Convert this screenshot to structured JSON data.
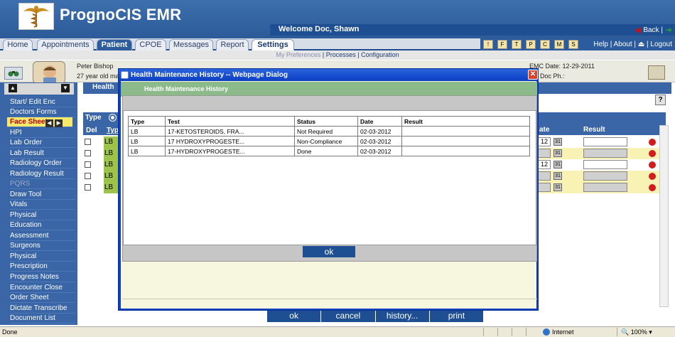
{
  "app": {
    "title": "PrognoCIS EMR",
    "welcome": "Welcome Doc, Shawn",
    "back_label": "Back |"
  },
  "tabs": [
    {
      "label": "Home"
    },
    {
      "label": "Appointments"
    },
    {
      "label": "Patient"
    },
    {
      "label": "CPOE"
    },
    {
      "label": "Messages"
    },
    {
      "label": "Report"
    },
    {
      "label": "Settings"
    }
  ],
  "help_links": "Help | About | ⏏ | Logout",
  "subnav": {
    "my_preferences": "My Preferences",
    "processes": "Processes",
    "configuration": "Configuration"
  },
  "patient": {
    "name": "Peter Bishop",
    "age": "27 year old mal",
    "emc_date": "EMC Date: 12-29-2011",
    "doc_ph": "Doc Ph.:"
  },
  "sidebar": {
    "items": [
      {
        "label": "Start/ Edit Enc"
      },
      {
        "label": "Doctors Forms"
      },
      {
        "label": "Face Sheet"
      },
      {
        "label": "HPI"
      },
      {
        "label": "Lab Order"
      },
      {
        "label": "Lab Result"
      },
      {
        "label": "Radiology Order"
      },
      {
        "label": "Radiology Result"
      },
      {
        "label": "PQRS"
      },
      {
        "label": "Draw Tool"
      },
      {
        "label": "Vitals"
      },
      {
        "label": "Physical"
      },
      {
        "label": "Education"
      },
      {
        "label": "Assessment"
      },
      {
        "label": "Surgeons"
      },
      {
        "label": "Physical"
      },
      {
        "label": "Prescription"
      },
      {
        "label": "Progress Notes"
      },
      {
        "label": "Encounter Close"
      },
      {
        "label": "Order Sheet"
      },
      {
        "label": "Dictate Transcribe"
      },
      {
        "label": "Document List"
      }
    ]
  },
  "main": {
    "header": "Health",
    "help_btn": "?",
    "col_type": "Type",
    "col_del": "Del",
    "col_typ": "Typ",
    "col_date": "ate",
    "col_result": "Result",
    "rows": [
      {
        "type": "LB",
        "date": "12",
        "bg": "#ffffff"
      },
      {
        "type": "LB",
        "date": "",
        "bg": "#f8f2b5"
      },
      {
        "type": "LB",
        "date": "12",
        "bg": "#ffffff"
      },
      {
        "type": "LB",
        "date": "",
        "bg": "#f8f2b5"
      },
      {
        "type": "LB",
        "date": "",
        "bg": "#f8f2b5"
      }
    ],
    "buttons": [
      "ok",
      "cancel",
      "history...",
      "print"
    ]
  },
  "dialog": {
    "title": "Health Maintenance History -- Webpage Dialog",
    "header": "Health Maintenance History",
    "table": {
      "columns": [
        "Type",
        "Test",
        "Status",
        "Date",
        "Result"
      ],
      "rows": [
        [
          "LB",
          "17-KETOSTEROIDS, FRA...",
          "Not Required",
          "02-03-2012",
          ""
        ],
        [
          "LB",
          "17 HYDROXYPROGESTE...",
          "Non-Compliance",
          "02-03-2012",
          ""
        ],
        [
          "LB",
          "17-HYDROXYPROGESTE...",
          "Done",
          "02-03-2012",
          ""
        ]
      ]
    },
    "ok_label": "ok"
  },
  "statusbar": {
    "done": "Done",
    "zone": "Internet",
    "zoom": "100%"
  }
}
